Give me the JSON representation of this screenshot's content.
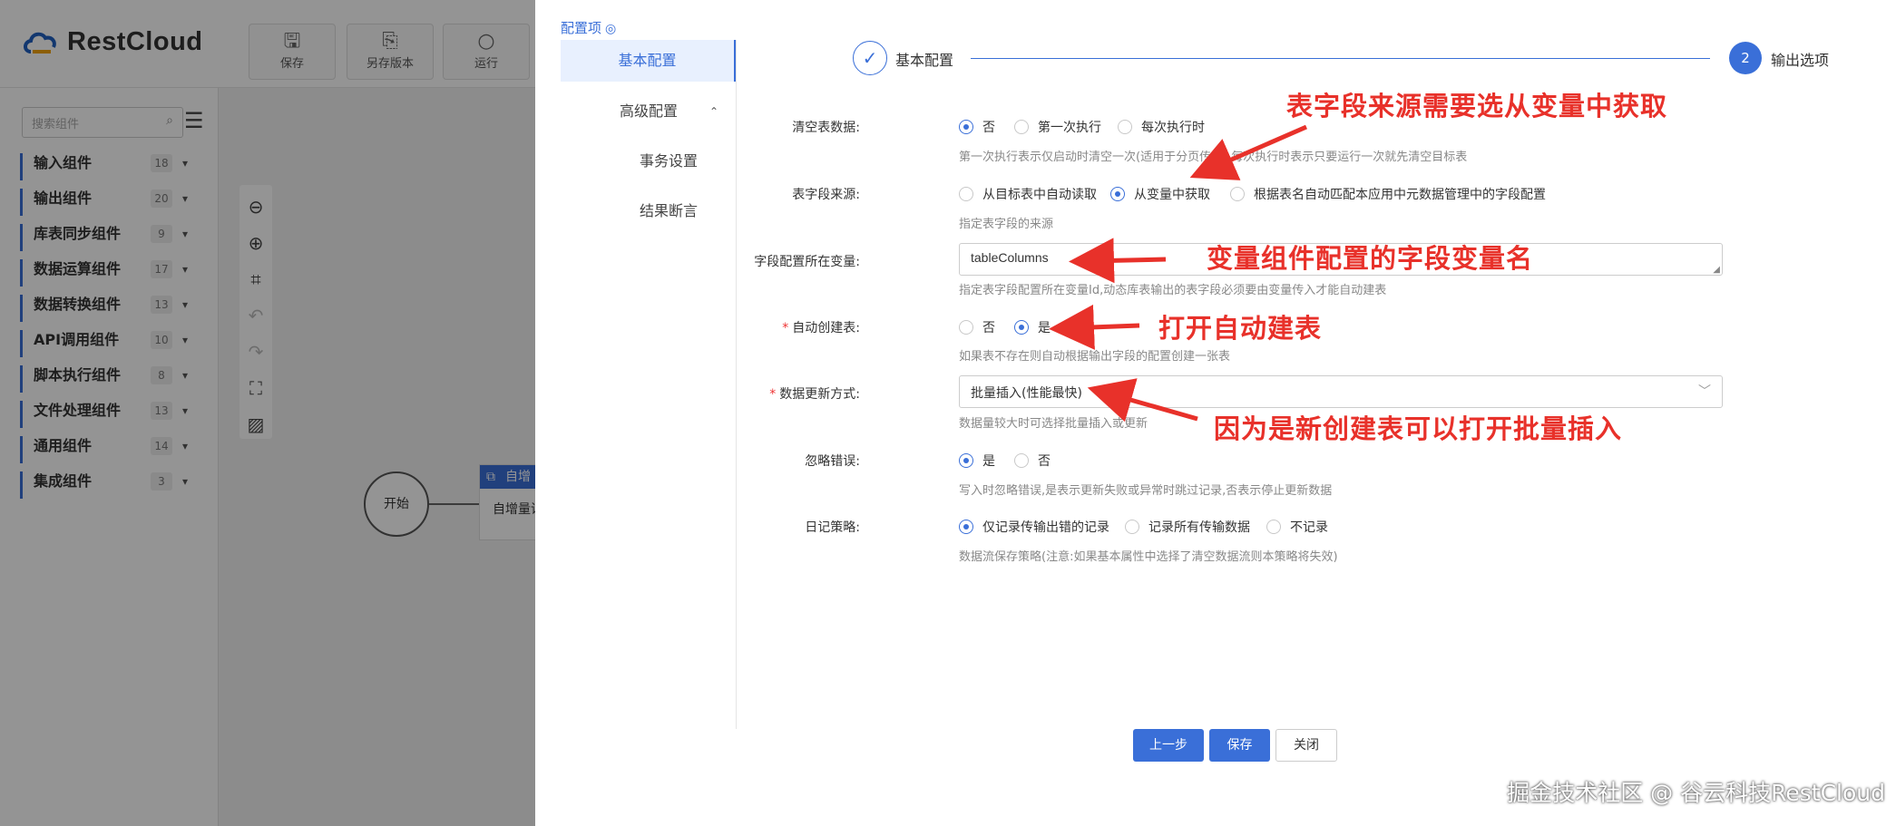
{
  "app": {
    "brand": "RestCloud",
    "toolbar": [
      {
        "label": "保存",
        "icon": "save-icon"
      },
      {
        "label": "另存版本",
        "icon": "save-as-icon"
      },
      {
        "label": "运行",
        "icon": "run-icon"
      }
    ],
    "search_placeholder": "搜索组件",
    "categories": [
      {
        "label": "输入组件",
        "count": "18"
      },
      {
        "label": "输出组件",
        "count": "20"
      },
      {
        "label": "库表同步组件",
        "count": "9"
      },
      {
        "label": "数据运算组件",
        "count": "17"
      },
      {
        "label": "数据转换组件",
        "count": "13"
      },
      {
        "label": "API调用组件",
        "count": "10"
      },
      {
        "label": "脚本执行组件",
        "count": "8"
      },
      {
        "label": "文件处理组件",
        "count": "13"
      },
      {
        "label": "通用组件",
        "count": "14"
      },
      {
        "label": "集成组件",
        "count": "3"
      }
    ],
    "start_node": "开始",
    "node_header": "自增",
    "node_body": "自增量读"
  },
  "drawer": {
    "config_title": "配置项",
    "menu": {
      "basic": "基本配置",
      "advanced": "高级配置",
      "transaction": "事务设置",
      "assertion": "结果断言"
    },
    "steps": {
      "step1": "基本配置",
      "step2_num": "2",
      "step2": "输出选项"
    },
    "form": {
      "clear_label": "清空表数据:",
      "clear_opts": [
        "否",
        "第一次执行",
        "每次执行时"
      ],
      "clear_hint": "第一次执行表示仅启动时清空一次(适用于分页传输),每次执行时表示只要运行一次就先清空目标表",
      "source_label": "表字段来源:",
      "source_opts": [
        "从目标表中自动读取",
        "从变量中获取",
        "根据表名自动匹配本应用中元数据管理中的字段配置"
      ],
      "source_hint": "指定表字段的来源",
      "var_label": "字段配置所在变量:",
      "var_value": "tableColumns",
      "var_hint": "指定表字段配置所在变量Id,动态库表输出的表字段必须要由变量传入才能自动建表",
      "auto_label": "自动创建表:",
      "auto_opts": [
        "否",
        "是"
      ],
      "auto_hint": "如果表不存在则自动根据输出字段的配置创建一张表",
      "update_label": "数据更新方式:",
      "update_value": "批量插入(性能最快)",
      "update_hint": "数据量较大时可选择批量插入或更新",
      "ignore_label": "忽略错误:",
      "ignore_opts": [
        "是",
        "否"
      ],
      "ignore_hint": "写入时忽略错误,是表示更新失败或异常时跳过记录,否表示停止更新数据",
      "log_label": "日记策略:",
      "log_opts": [
        "仅记录传输出错的记录",
        "记录所有传输数据",
        "不记录"
      ],
      "log_hint": "数据流保存策略(注意:如果基本属性中选择了清空数据流则本策略将失效)"
    },
    "buttons": {
      "prev": "上一步",
      "save": "保存",
      "close": "关闭"
    }
  },
  "annotations": {
    "a1": "表字段来源需要选从变量中获取",
    "a2": "变量组件配置的字段变量名",
    "a3": "打开自动建表",
    "a4": "因为是新创建表可以打开批量插入"
  },
  "watermark": "掘金技术社区 @ 谷云科技RestCloud",
  "colors": {
    "accent": "#3a6fd8",
    "annotation": "#e8312a"
  }
}
